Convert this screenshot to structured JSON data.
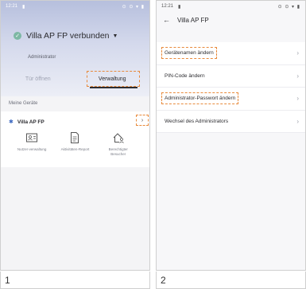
{
  "screen1": {
    "status_time": "12:21",
    "status_icons": "⊙ ⊙ ▾ ▮",
    "connection_title": "Villa AP FP verbunden",
    "role": "Administrator",
    "tabs": [
      {
        "label": "Tür öffnen"
      },
      {
        "label": "Verwaltung"
      }
    ],
    "section_label": "Meine Geräte",
    "device_name": "Villa AP FP",
    "more_symbol": "⋮ 〉",
    "actions": [
      {
        "label": "Nutzer-verwaltung"
      },
      {
        "label": "Aktivitäten-Report"
      },
      {
        "label": "Berechtigter Besucher"
      }
    ],
    "caption": "1"
  },
  "screen2": {
    "status_time": "12:21",
    "status_icons": "⊙ ⊙ ▾ ▮",
    "title": "Villa AP FP",
    "menu": [
      {
        "label": "Gerätenamen ändern",
        "highlighted": true
      },
      {
        "label": "PIN-Code ändern",
        "highlighted": false
      },
      {
        "label": "Administrator-Passwort ändern",
        "highlighted": true
      },
      {
        "label": "Wechsel des Administrators",
        "highlighted": false
      }
    ],
    "caption": "2"
  },
  "colors": {
    "highlight": "#e88a3c",
    "bluetooth": "#7db8a4",
    "hero_top": "#b6bfdd"
  }
}
